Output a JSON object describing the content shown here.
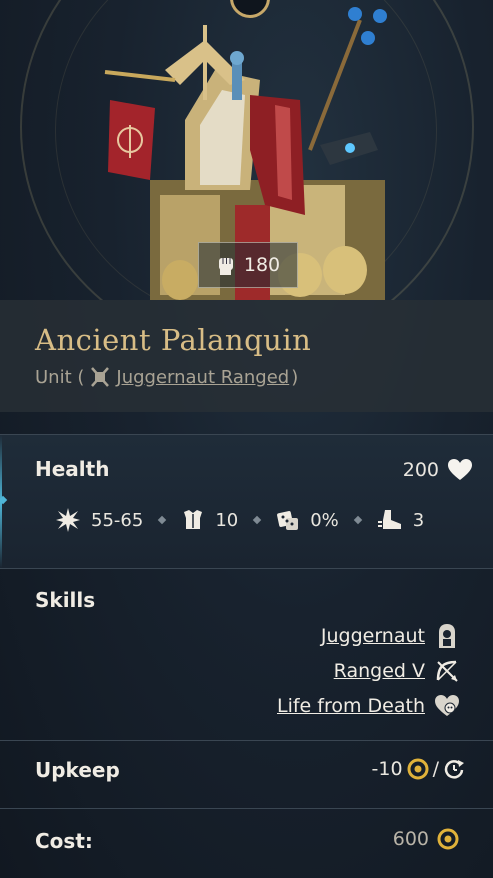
{
  "portrait": {
    "power_value": "180",
    "power_icon": "fist-icon"
  },
  "unit": {
    "name": "Ancient Palanquin",
    "type_prefix": "Unit (",
    "type_link": "Juggernaut Ranged",
    "type_suffix": ")",
    "type_icon": "juggernaut-ranged-icon"
  },
  "health": {
    "label": "Health",
    "value": "200",
    "icon": "heart-icon"
  },
  "stats": [
    {
      "name": "damage",
      "icon": "burst-icon",
      "value": "55-65"
    },
    {
      "name": "defense",
      "icon": "armor-icon",
      "value": "10"
    },
    {
      "name": "chance",
      "icon": "dice-icon",
      "value": "0%"
    },
    {
      "name": "movement",
      "icon": "boot-icon",
      "value": "3"
    }
  ],
  "skills": {
    "label": "Skills",
    "items": [
      {
        "label": "Juggernaut",
        "icon": "juggernaut-icon"
      },
      {
        "label": "Ranged V",
        "icon": "bow-icon"
      },
      {
        "label": "Life from Death",
        "icon": "heart-skull-icon"
      }
    ]
  },
  "upkeep": {
    "label": "Upkeep",
    "value": "-10",
    "separator": "/",
    "icons": [
      "gold-coin-icon",
      "turn-icon"
    ]
  },
  "cost": {
    "label": "Cost:",
    "value": "600",
    "icon": "gold-coin-icon"
  },
  "colors": {
    "title_gold": "#d8bd86",
    "accent_blue": "#4fb6d8",
    "coin_gold": "#e0b23a"
  }
}
